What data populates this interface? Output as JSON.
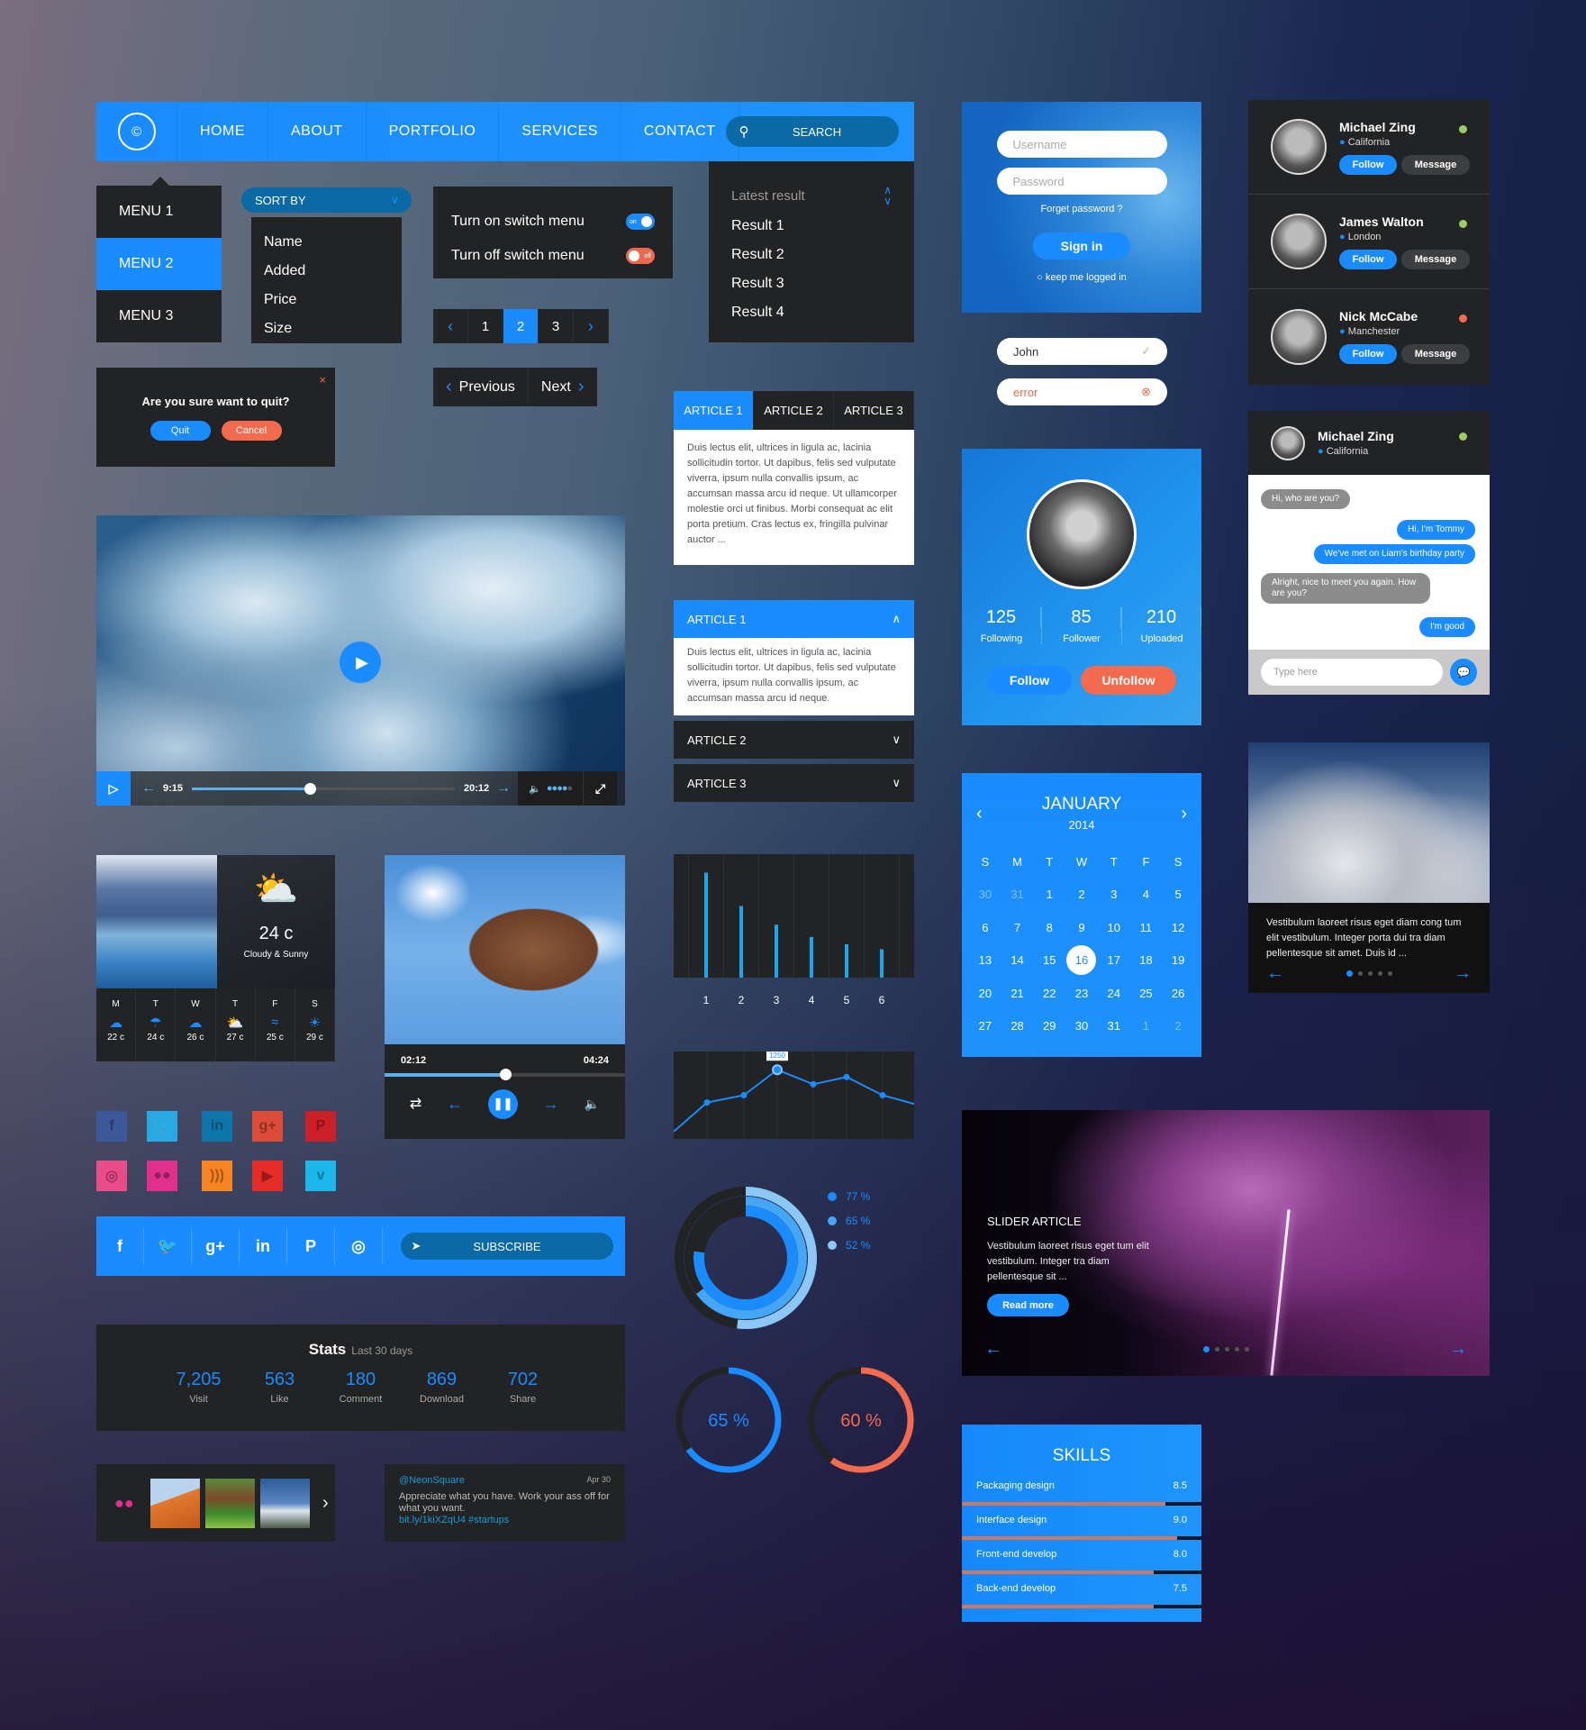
{
  "nav": {
    "logo_glyph": "©",
    "items": [
      "HOME",
      "ABOUT",
      "PORTFOLIO",
      "SERVICES",
      "CONTACT"
    ],
    "search_label": "SEARCH"
  },
  "menu": {
    "items": [
      "MENU 1",
      "MENU 2",
      "MENU 3"
    ],
    "active_index": 1
  },
  "sort": {
    "label": "SORT BY",
    "options": [
      "Name",
      "Added",
      "Price",
      "Size"
    ]
  },
  "switches": {
    "on_label": "Turn on switch menu",
    "on_state": "on",
    "off_label": "Turn off switch menu",
    "off_state": "off"
  },
  "pager": {
    "pages": [
      "1",
      "2",
      "3"
    ],
    "current": "2"
  },
  "latest": {
    "title": "Latest result",
    "results": [
      "Result 1",
      "Result 2",
      "Result 3",
      "Result 4"
    ]
  },
  "login": {
    "username_placeholder": "Username",
    "password_placeholder": "Password",
    "forgot": "Forget password ?",
    "signin": "Sign in",
    "keep": "keep me logged in"
  },
  "inputs": {
    "valid_value": "John",
    "error_value": "error"
  },
  "people": [
    {
      "name": "Michael Zing",
      "location": "California",
      "status": "online",
      "status_color": "#9ccc65"
    },
    {
      "name": "James Walton",
      "location": "London",
      "status": "online",
      "status_color": "#9ccc65"
    },
    {
      "name": "Nick McCabe",
      "location": "Manchester",
      "status": "busy",
      "status_color": "#f26b4f"
    }
  ],
  "people_buttons": {
    "follow": "Follow",
    "message": "Message"
  },
  "quit_dialog": {
    "question": "Are you sure want to quit?",
    "quit": "Quit",
    "cancel": "Cancel",
    "close": "×"
  },
  "prevnext": {
    "prev": "Previous",
    "next": "Next"
  },
  "tabs": {
    "labels": [
      "ARTICLE 1",
      "ARTICLE 2",
      "ARTICLE 3"
    ],
    "active_index": 0,
    "content": "Duis lectus elit, ultrices in ligula ac, lacinia sollicitudin tortor. Ut dapibus, felis sed vulputate viverra, ipsum nulla convallis ipsum, ac accumsan massa arcu id neque. Ut ullamcorper molestie orci ut finibus. Morbi consequat ac elit porta pretium. Cras lectus ex, fringilla pulvinar auctor ..."
  },
  "accordion": {
    "items": [
      "ARTICLE 1",
      "ARTICLE 2",
      "ARTICLE 3"
    ],
    "open_index": 0,
    "content": "Duis lectus elit, ultrices in ligula ac, lacinia sollicitudin tortor. Ut dapibus, felis sed vulputate viverra, ipsum nulla convallis ipsum, ac accumsan massa arcu id neque."
  },
  "video": {
    "current": "9:15",
    "total": "20:12",
    "progress": 0.45,
    "volume_level": 4,
    "volume_max": 5
  },
  "profile": {
    "stats": [
      {
        "value": "125",
        "label": "Following"
      },
      {
        "value": "85",
        "label": "Follower"
      },
      {
        "value": "210",
        "label": "Uploaded"
      }
    ],
    "follow": "Follow",
    "unfollow": "Unfollow"
  },
  "chat": {
    "name": "Michael Zing",
    "location": "California",
    "status_color": "#9ccc65",
    "messages": [
      {
        "dir": "in",
        "text": "Hi, who are you?"
      },
      {
        "dir": "out",
        "text": "Hi, I'm Tommy"
      },
      {
        "dir": "out",
        "text": "We've met on Liam's birthday party"
      },
      {
        "dir": "in",
        "text": "Alright, nice to meet you again. How are you?"
      },
      {
        "dir": "out",
        "text": "I'm good"
      }
    ],
    "input_placeholder": "Type here"
  },
  "weather": {
    "temp": "24 c",
    "desc": "Cloudy & Sunny",
    "days": [
      {
        "d": "M",
        "icon": "storm",
        "t": "22 c"
      },
      {
        "d": "T",
        "icon": "rain",
        "t": "24 c"
      },
      {
        "d": "W",
        "icon": "cloud",
        "t": "26 c"
      },
      {
        "d": "T",
        "icon": "partly-cloudy",
        "t": "27 c"
      },
      {
        "d": "F",
        "icon": "wind",
        "t": "25 c"
      },
      {
        "d": "S",
        "icon": "sun",
        "t": "29 c"
      }
    ]
  },
  "music": {
    "current": "02:12",
    "total": "04:24",
    "progress": 0.5
  },
  "calendar": {
    "month": "JANUARY",
    "year": "2014",
    "weekdays": [
      "S",
      "M",
      "T",
      "W",
      "T",
      "F",
      "S"
    ],
    "days": [
      "30",
      "31",
      "1",
      "2",
      "3",
      "4",
      "5",
      "6",
      "7",
      "8",
      "9",
      "10",
      "11",
      "12",
      "13",
      "14",
      "15",
      "16",
      "17",
      "18",
      "19",
      "20",
      "21",
      "22",
      "23",
      "24",
      "25",
      "26",
      "27",
      "28",
      "29",
      "30",
      "31",
      "1",
      "2"
    ],
    "dim_indices": [
      0,
      1,
      33,
      34
    ],
    "selected": "16"
  },
  "cloud_slider": {
    "text": "Vestibulum laoreet risus eget diam cong tum elit vestibulum. Integer porta dui tra diam pellentesque sit amet. Duis id ...",
    "slides": 5,
    "active": 0
  },
  "social_icons": [
    {
      "name": "facebook",
      "glyph": "f",
      "color": "#3b5998"
    },
    {
      "name": "twitter",
      "glyph": "🐦",
      "color": "#29a9e1"
    },
    {
      "name": "linkedin",
      "glyph": "in",
      "color": "#0e76a8"
    },
    {
      "name": "googleplus",
      "glyph": "g+",
      "color": "#dd4b39"
    },
    {
      "name": "pinterest",
      "glyph": "P",
      "color": "#cb2027"
    },
    {
      "name": "dribbble",
      "glyph": "◎",
      "color": "#ea4c89"
    },
    {
      "name": "flickr",
      "glyph": "●●",
      "color": "#e0308d"
    },
    {
      "name": "rss",
      "glyph": ")))",
      "color": "#f78422"
    },
    {
      "name": "youtube",
      "glyph": "▶",
      "color": "#e52d27"
    },
    {
      "name": "vimeo",
      "glyph": "v",
      "color": "#1ab7ea"
    }
  ],
  "share": {
    "icons": [
      "f",
      "t",
      "g+",
      "in",
      "P",
      "◎"
    ],
    "subscribe": "SUBSCRIBE"
  },
  "stats": {
    "title": "Stats",
    "subtitle": "Last 30 days",
    "items": [
      {
        "value": "7,205",
        "label": "Visit"
      },
      {
        "value": "563",
        "label": "Like"
      },
      {
        "value": "180",
        "label": "Comment"
      },
      {
        "value": "869",
        "label": "Download"
      },
      {
        "value": "702",
        "label": "Share"
      }
    ]
  },
  "lightning_slider": {
    "title": "SLIDER ARTICLE",
    "text": "Vestibulum laoreet risus eget tum elit vestibulum. Integer tra diam pellentesque sit ...",
    "button": "Read more",
    "slides": 5,
    "active": 0
  },
  "tweet": {
    "user": "@NeonSquare",
    "date": "Apr 30",
    "text": "Appreciate what you have. Work your ass off for what you want.",
    "link": "bit.ly/1kiXZqU4 #startups"
  },
  "skills": {
    "title": "SKILLS",
    "items": [
      {
        "name": "Packaging design",
        "value": "8.5",
        "level": 0.85
      },
      {
        "name": "Interface design",
        "value": "9.0",
        "level": 0.9
      },
      {
        "name": "Front-end develop",
        "value": "8.0",
        "level": 0.8
      },
      {
        "name": "Back-end develop",
        "value": "7.5",
        "level": 0.8
      }
    ]
  },
  "chart_data": [
    {
      "type": "bar",
      "categories": [
        "1",
        "2",
        "3",
        "4",
        "5",
        "6"
      ],
      "values": [
        85,
        58,
        43,
        33,
        27,
        23
      ],
      "title": "",
      "xlabel": "",
      "ylabel": "",
      "ylim": [
        0,
        100
      ],
      "grid": true
    },
    {
      "type": "line",
      "x": [
        0,
        1,
        2,
        3,
        4,
        5,
        6,
        7
      ],
      "values": [
        400,
        800,
        900,
        1250,
        1050,
        1150,
        900,
        780
      ],
      "highlight": {
        "index": 3,
        "label": "1250"
      },
      "ylim": [
        300,
        1500
      ],
      "grid": true
    },
    {
      "type": "pie",
      "title": "",
      "series": [
        {
          "name": "77 %",
          "value": 77,
          "color": "#1a8cff"
        },
        {
          "name": "65 %",
          "value": 65,
          "color": "#45a6f5"
        },
        {
          "name": "52 %",
          "value": 52,
          "color": "#8cc8f7"
        }
      ],
      "legend": "right"
    },
    {
      "type": "pie",
      "label": "65 %",
      "value": 65,
      "color": "#1a8cff"
    },
    {
      "type": "pie",
      "label": "60 %",
      "value": 60,
      "color": "#f26b4f"
    }
  ],
  "colors": {
    "accent": "#1a8cff",
    "dark": "#222324",
    "danger": "#f26b4f",
    "dark_blue": "#0b6aa6"
  }
}
